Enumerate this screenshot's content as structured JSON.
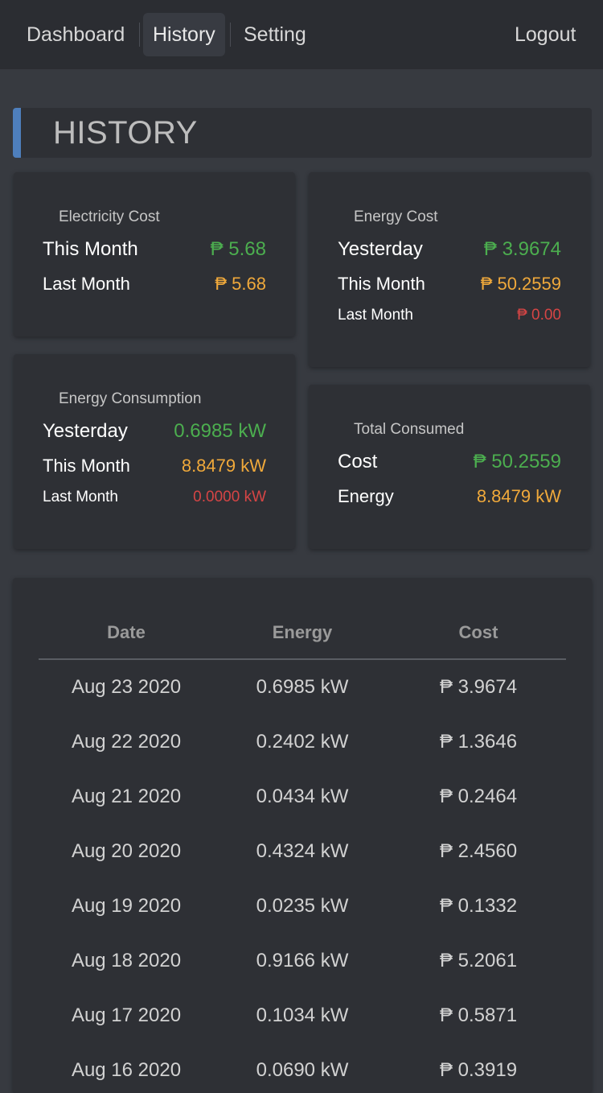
{
  "nav": {
    "dashboard": "Dashboard",
    "history": "History",
    "setting": "Setting",
    "logout": "Logout"
  },
  "page_title": "HISTORY",
  "electricity_cost": {
    "title": "Electricity Cost",
    "this_month_label": "This Month",
    "this_month_value": "₱ 5.68",
    "last_month_label": "Last Month",
    "last_month_value": "₱ 5.68"
  },
  "energy_cost": {
    "title": "Energy Cost",
    "yesterday_label": "Yesterday",
    "yesterday_value": "₱ 3.9674",
    "this_month_label": "This Month",
    "this_month_value": "₱ 50.2559",
    "last_month_label": "Last Month",
    "last_month_value": "₱ 0.00"
  },
  "energy_consumption": {
    "title": "Energy Consumption",
    "yesterday_label": "Yesterday",
    "yesterday_value": "0.6985 kW",
    "this_month_label": "This Month",
    "this_month_value": "8.8479 kW",
    "last_month_label": "Last Month",
    "last_month_value": "0.0000 kW"
  },
  "total_consumed": {
    "title": "Total Consumed",
    "cost_label": "Cost",
    "cost_value": "₱ 50.2559",
    "energy_label": "Energy",
    "energy_value": "8.8479 kW"
  },
  "table": {
    "headers": [
      "Date",
      "Energy",
      "Cost"
    ],
    "rows": [
      [
        "Aug 23 2020",
        "0.6985 kW",
        "₱ 3.9674"
      ],
      [
        "Aug 22 2020",
        "0.2402 kW",
        "₱ 1.3646"
      ],
      [
        "Aug 21 2020",
        "0.0434 kW",
        "₱ 0.2464"
      ],
      [
        "Aug 20 2020",
        "0.4324 kW",
        "₱ 2.4560"
      ],
      [
        "Aug 19 2020",
        "0.0235 kW",
        "₱ 0.1332"
      ],
      [
        "Aug 18 2020",
        "0.9166 kW",
        "₱ 5.2061"
      ],
      [
        "Aug 17 2020",
        "0.1034 kW",
        "₱ 0.5871"
      ],
      [
        "Aug 16 2020",
        "0.0690 kW",
        "₱ 0.3919"
      ]
    ]
  },
  "colors": {
    "accent": "#4e7fbd",
    "green": "#4cae4f",
    "orange": "#f0a93b",
    "red": "#d64545"
  }
}
